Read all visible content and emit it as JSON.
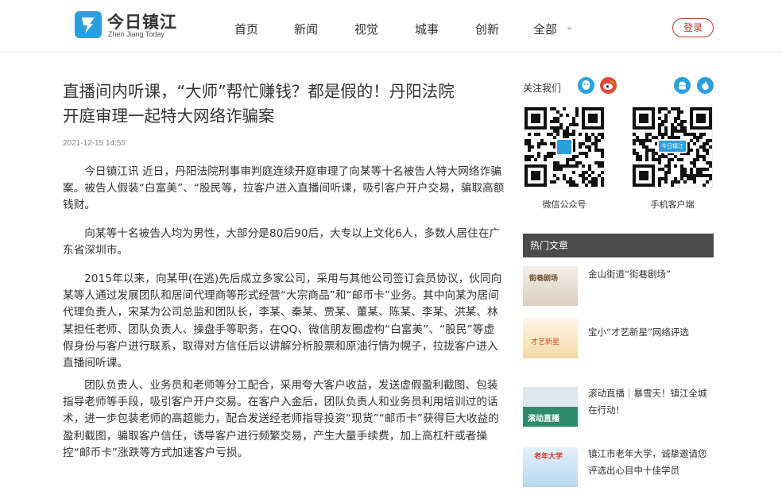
{
  "header": {
    "logo_cn": "今日镇江",
    "logo_en": "Zhen Jiang Today",
    "nav": [
      "首页",
      "新闻",
      "视觉",
      "城事",
      "创新",
      "全部"
    ],
    "login_label": "登录"
  },
  "article": {
    "title_line1": "直播间内听课，“大师”帮忙赚钱？都是假的！丹阳法院",
    "title_line2": "开庭审理一起特大网络诈骗案",
    "date": "2021-12-15 14:55",
    "paragraphs": [
      "今日镇江讯 近日，丹阳法院刑事审判庭连续开庭审理了向某等十名被告人特大网络诈骗案。被告人假装“白富美”、“股民等，拉客户进入直播间听课，吸引客户开户交易，骗取高额钱财。",
      "向某等十名被告人均为男性，大部分是80后90后，大专以上文化6人，多数人居住在广东省深圳市。",
      "2015年以来，向某甲(在逃)先后成立多家公司，采用与其他公司签订会员协议，伙同向某等人通过发展团队和居间代理商等形式经营“大宗商品”和“邮币卡”业务。其中向某为居间代理负责人，宋某为公司总监和团队长，李某、秦某、贾某、董某、陈某、李某、洪某、林某担任老师、团队负责人、操盘手等职务，在QQ、微信朋友圈虚构“白富美”、“股民”等虚假身份与客户进行联系，取得对方信任后以讲解分析股票和原油行情为幌子，拉拢客户进入直播间听课。",
      "团队负责人、业务员和老师等分工配合，采用夸大客户收益，发送虚假盈利截图、包装指导老师等手段，吸引客户开户交易。在客户入金后，团队负责人和业务员利用培训过的话术，进一步包装老师的高超能力，配合发送经老师指导投资“现货”“邮币卡”获得巨大收益的盈利截图，骗取客户信任，诱导客户进行频繁交易，产生大量手续费，加上高杠杆或者操控“邮币卡”涨跌等方式加速客户亏损。"
    ]
  },
  "sidebar": {
    "follow_label": "关注我们",
    "qr_wechat_label": "微信公众号",
    "qr_app_label": "手机客户端",
    "qr_app_badge": "今日镇江",
    "hot_title": "热门文章",
    "hot_items": [
      {
        "title": "金山街道“街巷剧场”",
        "thumb_text": "街巷剧场"
      },
      {
        "title": "宝小“才艺新星”网络评选",
        "thumb_text": "才艺新星"
      },
      {
        "title": "滚动直播｜暴雪天！镇江全城在行动！",
        "thumb_text": "滚动直播"
      },
      {
        "title": "镇江市老年大学，诚挚邀请您评选出心目中十佳学员",
        "thumb_text": "老年大学"
      }
    ]
  },
  "colors": {
    "brand_blue": "#2a9fe0",
    "login_red": "#c0392b",
    "hot_bar": "#4b4b4b"
  }
}
